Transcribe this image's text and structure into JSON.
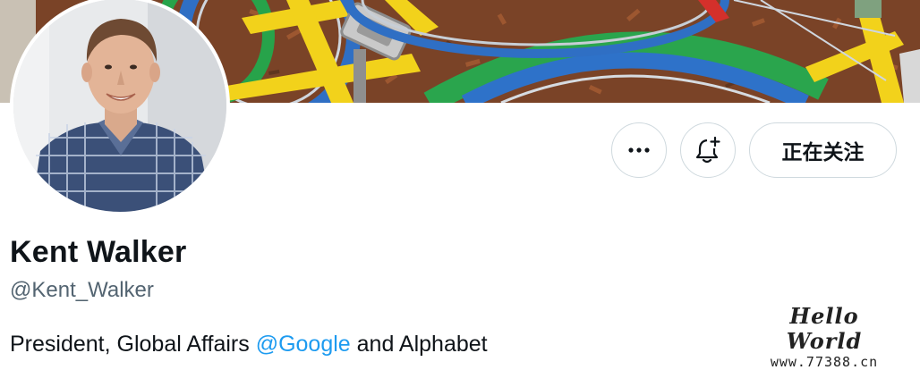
{
  "profile": {
    "name": "Kent Walker",
    "handle": "@Kent_Walker",
    "bio": {
      "prefix": "President, Global Affairs ",
      "mention": "@Google",
      "suffix": " and Alphabet"
    }
  },
  "actions": {
    "more_icon": "more-horizontal-icon",
    "bell_icon": "bell-plus-icon",
    "follow_label": "正在关注"
  },
  "watermark": {
    "title": "Hello World",
    "url": "www.77388.cn"
  },
  "colors": {
    "link": "#1d9bf0",
    "text": "#0f1419",
    "secondary_text": "#536471",
    "button_border": "#cfd9de"
  }
}
